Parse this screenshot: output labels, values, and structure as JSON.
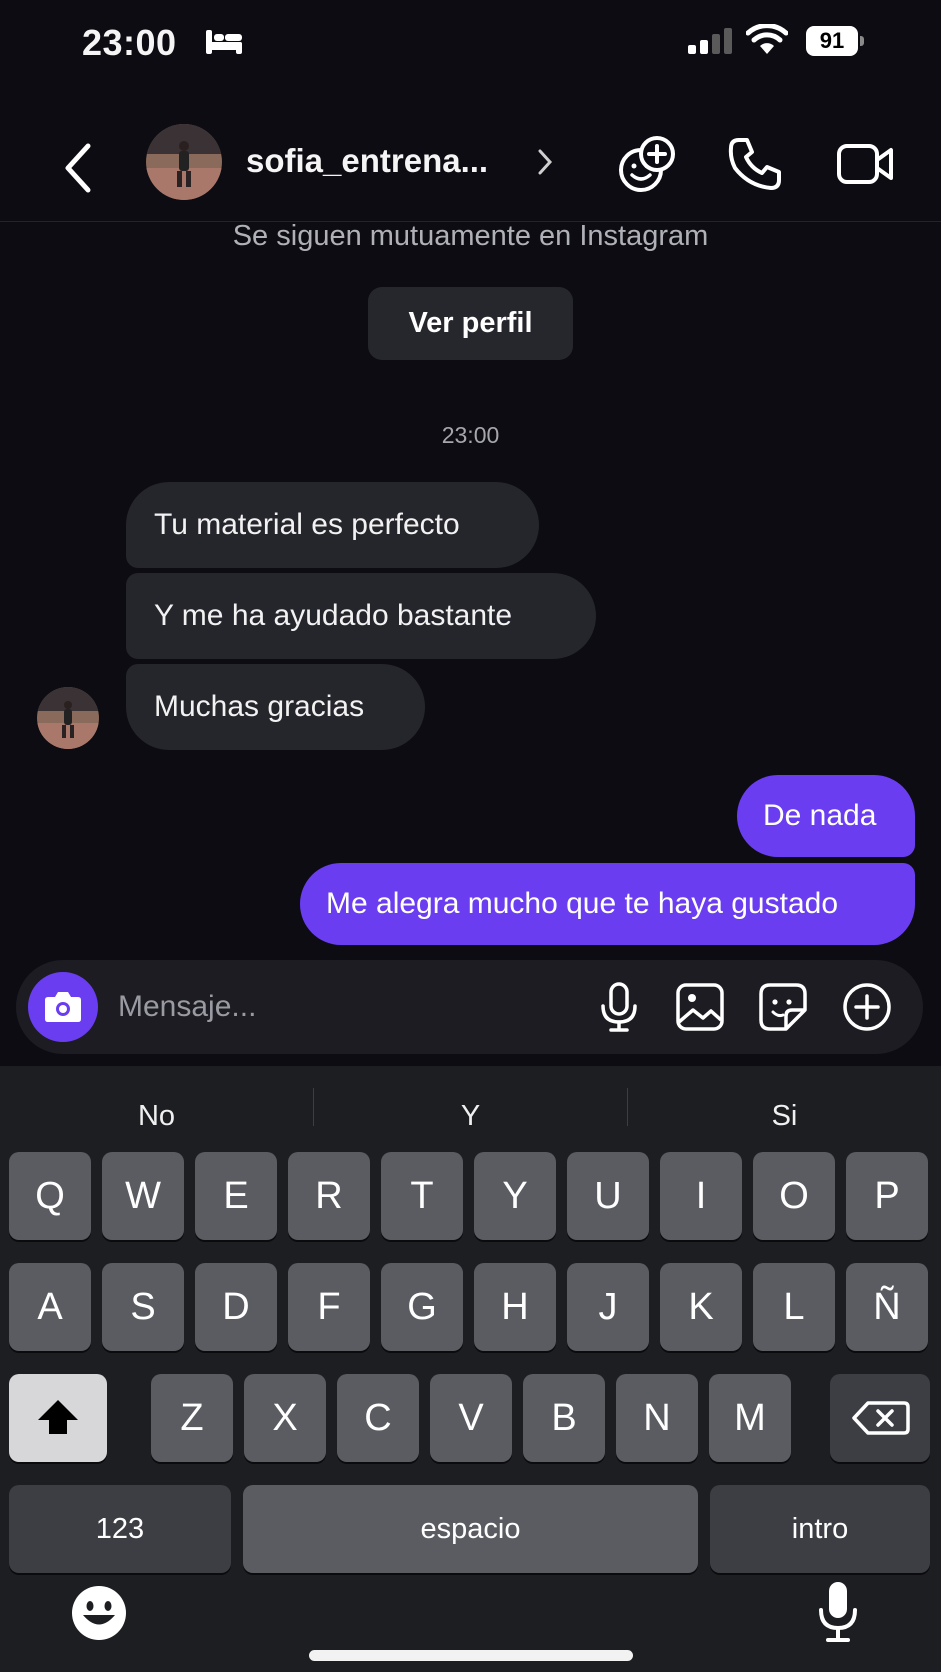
{
  "status_bar": {
    "time": "23:00",
    "battery": "91"
  },
  "header": {
    "username": "sofia_entrena..."
  },
  "chat": {
    "mutual_text": "Se siguen mutuamente en Instagram",
    "view_profile": "Ver perfil",
    "timestamp": "23:00",
    "incoming": [
      "Tu material es perfecto",
      "Y me ha ayudado bastante",
      "Muchas gracias"
    ],
    "outgoing": [
      "De nada",
      "Me alegra mucho que te haya gustado"
    ]
  },
  "composer": {
    "placeholder": "Mensaje..."
  },
  "keyboard": {
    "suggestions": [
      "No",
      "Y",
      "Si"
    ],
    "row1": [
      "Q",
      "W",
      "E",
      "R",
      "T",
      "Y",
      "U",
      "I",
      "O",
      "P"
    ],
    "row2": [
      "A",
      "S",
      "D",
      "F",
      "G",
      "H",
      "J",
      "K",
      "L",
      "Ñ"
    ],
    "row3": [
      "Z",
      "X",
      "C",
      "V",
      "B",
      "N",
      "M"
    ],
    "numbers_label": "123",
    "space_label": "espacio",
    "return_label": "intro"
  },
  "colors": {
    "background": "#0c0c12",
    "accent": "#6a3ef0",
    "incoming_bubble": "#25252c",
    "keyboard_bg": "#1d1e22",
    "key": "#5b5c62"
  },
  "icons": [
    "bed-icon",
    "signal-icon",
    "wifi-icon",
    "back-icon",
    "chevron-right-icon",
    "add-friend-icon",
    "phone-icon",
    "video-icon",
    "camera-icon",
    "mic-icon",
    "image-icon",
    "sticker-icon",
    "plus-icon",
    "shift-icon",
    "backspace-icon",
    "emoji-icon",
    "dictation-icon"
  ]
}
